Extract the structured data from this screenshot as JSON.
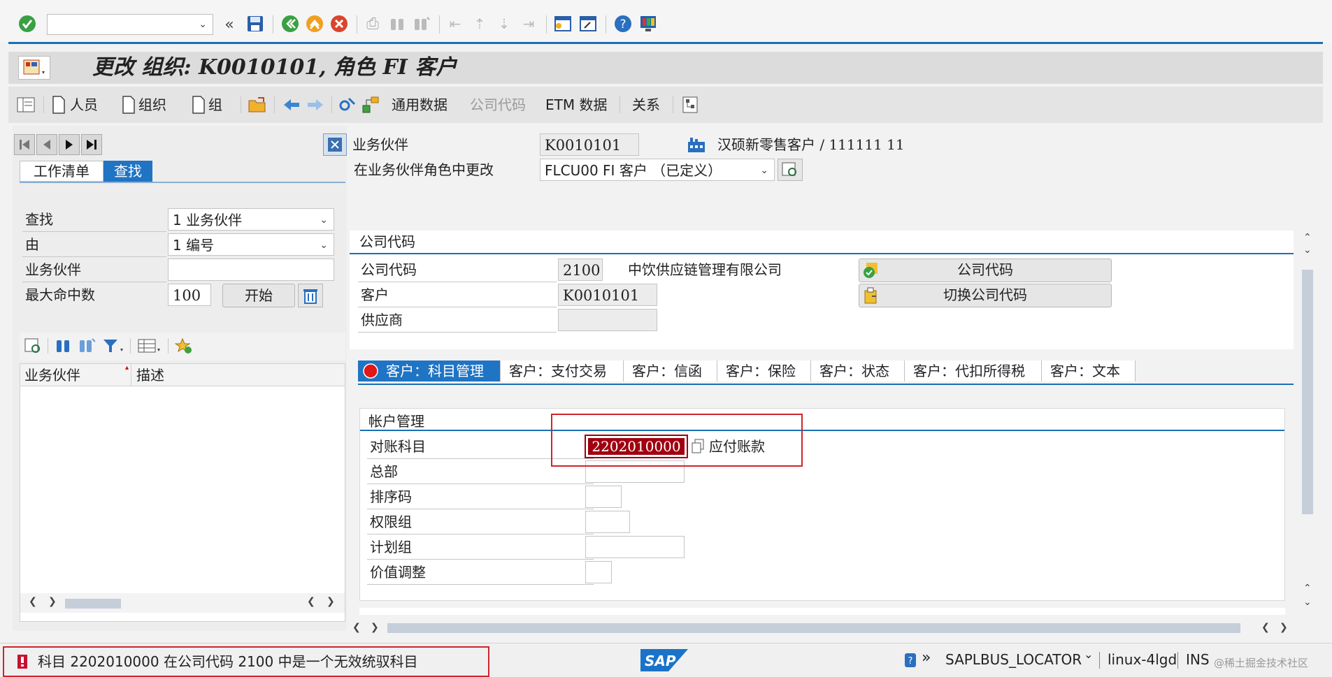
{
  "toolbar": {
    "command_field_value": "",
    "command_field_placeholder": ""
  },
  "title_bar": {
    "title": "更改 组织: K0010101, 角色 FI 客户"
  },
  "app_toolbar": {
    "person_label": "人员",
    "org_label": "组织",
    "group_label": "组",
    "general_data_label": "通用数据",
    "company_code_label": "公司代码",
    "etm_label": "ETM 数据",
    "relations_label": "关系"
  },
  "left_panel": {
    "tabs": [
      {
        "label": "工作清单"
      },
      {
        "label": "查找"
      }
    ],
    "search": {
      "find_label": "查找",
      "find_value": "1 业务伙伴",
      "by_label": "由",
      "by_value": "1 编号",
      "bp_label": "业务伙伴",
      "bp_value": "",
      "max_hits_label": "最大命中数",
      "max_hits_value": "100",
      "start_button": "开始"
    },
    "result_columns": [
      "业务伙伴",
      "描述"
    ]
  },
  "header": {
    "bp_label": "业务伙伴",
    "bp_value": "K0010101",
    "bp_name": "汉硕新零售客户 / 111111 11",
    "role_label": "在业务伙伴角色中更改",
    "role_value": "FLCU00 FI 客户 （已定义）"
  },
  "company_code_section": {
    "title": "公司代码",
    "cc_label": "公司代码",
    "cc_value": "2100",
    "cc_name": "中饮供应链管理有限公司",
    "customer_label": "客户",
    "customer_value": "K0010101",
    "vendor_label": "供应商",
    "vendor_value": "",
    "btn_company_code": "公司代码",
    "btn_switch_company_code": "切换公司代码"
  },
  "detail_tabs": [
    {
      "label": "客户：科目管理"
    },
    {
      "label": "客户：支付交易"
    },
    {
      "label": "客户：信函"
    },
    {
      "label": "客户：保险"
    },
    {
      "label": "客户：状态"
    },
    {
      "label": "客户：代扣所得税"
    },
    {
      "label": "客户：文本"
    }
  ],
  "account_mgmt": {
    "title": "帐户管理",
    "recon_label": "对账科目",
    "recon_value": "2202010000",
    "recon_desc": "应付账款",
    "head_office_label": "总部",
    "sort_key_label": "排序码",
    "auth_group_label": "权限组",
    "planning_group_label": "计划组",
    "value_adjust_label": "价值调整"
  },
  "status_bar": {
    "message": "科目 2202010000 在公司代码 2100 中是一个无效统驭科目",
    "logo": "SAP",
    "program": "SAPLBUS_LOCATOR",
    "server": "linux-4lgd",
    "mode": "INS",
    "watermark": "@稀土掘金技术社区"
  },
  "colors": {
    "accent_blue": "#1b6fb5",
    "error_red": "#c8102e",
    "highlight_red": "#a0000f"
  }
}
